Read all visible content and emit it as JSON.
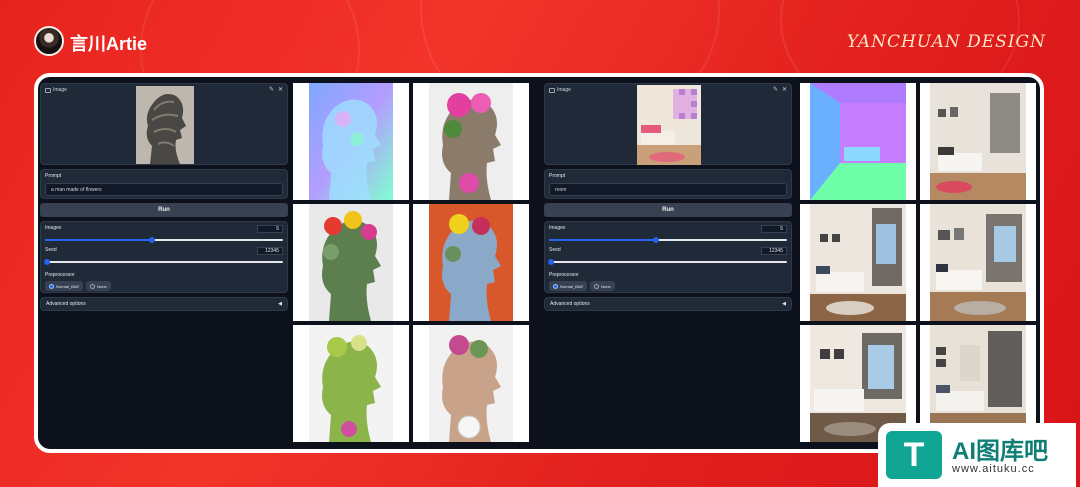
{
  "header": {
    "brand": "言川Artie",
    "design_mark": "YANCHUAN DESIGN"
  },
  "left_demo": {
    "image_label": "Image",
    "prompt_label": "Prompt",
    "prompt_value": "a man made of flowers",
    "run_label": "Run",
    "images_label": "Images",
    "images_value": "5",
    "images_fraction": 0.45,
    "seed_label": "Seed",
    "seed_value": "12345",
    "seed_fraction": 0.01,
    "preprocessor_label": "Preprocessor",
    "preprocessor_options": [
      "Normal_BAE",
      "None"
    ],
    "advanced_label": "Advanced options"
  },
  "right_demo": {
    "image_label": "Image",
    "prompt_label": "Prompt",
    "prompt_value": "room",
    "run_label": "Run",
    "images_label": "Images",
    "images_value": "5",
    "images_fraction": 0.45,
    "seed_label": "Seed",
    "seed_value": "12345",
    "seed_fraction": 0.01,
    "preprocessor_label": "Preprocessor",
    "preprocessor_options": [
      "Normal_BAE",
      "None"
    ],
    "advanced_label": "Advanced options"
  },
  "icons": {
    "edit": "pencil-icon",
    "close": "close-icon",
    "collapse": "triangle-left-icon"
  },
  "watermark": {
    "logo_letter": "T",
    "name": "AI图库吧",
    "url": "www.aituku.cc"
  },
  "colors": {
    "background_red": "#e8231f",
    "panel": "#0c111b",
    "accent_blue": "#2563eb",
    "watermark_teal": "#11a596"
  }
}
